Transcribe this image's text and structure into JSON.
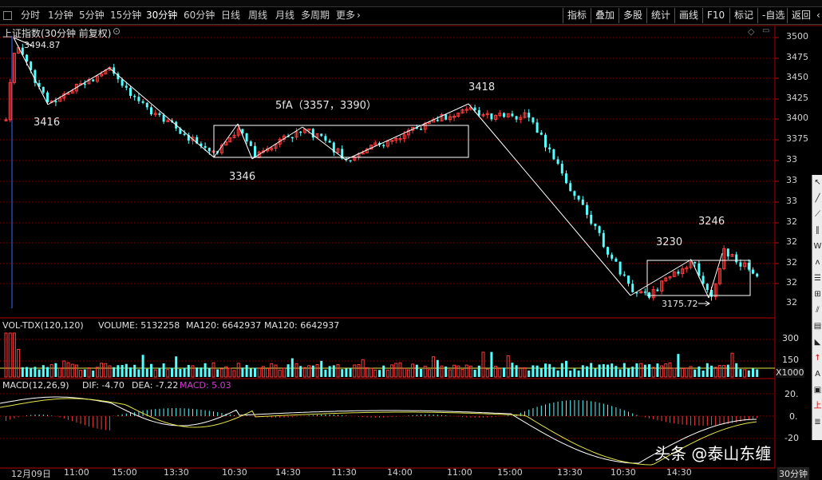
{
  "toolbar": {
    "items": [
      "分时",
      "1分钟",
      "5分钟",
      "15分钟",
      "30分钟",
      "60分钟",
      "日线",
      "周线",
      "月线",
      "多周期",
      "更多"
    ],
    "active": "30分钟",
    "right_items": [
      "指标",
      "叠加",
      "多股",
      "统计",
      "画线",
      "F10",
      "标记",
      "-自选",
      "返回"
    ]
  },
  "header": {
    "title": "上证指数(30分钟 前复权)"
  },
  "annotations": {
    "high_3494": "3494.87",
    "p3416": "3416",
    "p3346": "3346",
    "range": "5fA（3357，3390）",
    "p3418": "3418",
    "p3230": "3230",
    "p3246": "3246",
    "low_3175": "3175.72"
  },
  "volume_panel": {
    "label": "VOL-TDX(120,120)",
    "volume": "VOLUME: 5132258",
    "ma1": "MA120: 6642937",
    "ma2": "MA120: 6642937",
    "unit": "X1000",
    "ticks": [
      "300",
      "150"
    ]
  },
  "macd_panel": {
    "label": "MACD(12,26,9)",
    "dif": "DIF: -4.70",
    "dea": "DEA: -7.22",
    "macd": "MACD: 5.03",
    "ticks": [
      "20.",
      "0.",
      "-20"
    ]
  },
  "y_axis": [
    "3500",
    "3475",
    "3450",
    "3425",
    "3400",
    "3375",
    "33",
    "33",
    "33",
    "32",
    "32",
    "32",
    "32",
    "32"
  ],
  "x_axis": [
    "12月09日",
    "11:00",
    "15:00",
    "13:30",
    "10:30",
    "14:30",
    "11:30",
    "14:00",
    "11:00",
    "15:00",
    "13:30",
    "10:30",
    "14:30"
  ],
  "period_label": "30分钟",
  "colors": {
    "up": "#ff3b3b",
    "down": "#54ffff",
    "line": "#ffffff",
    "ma": "#e6e64a",
    "grid": "#8b0000"
  },
  "watermark": "头条 @泰山东缠"
}
